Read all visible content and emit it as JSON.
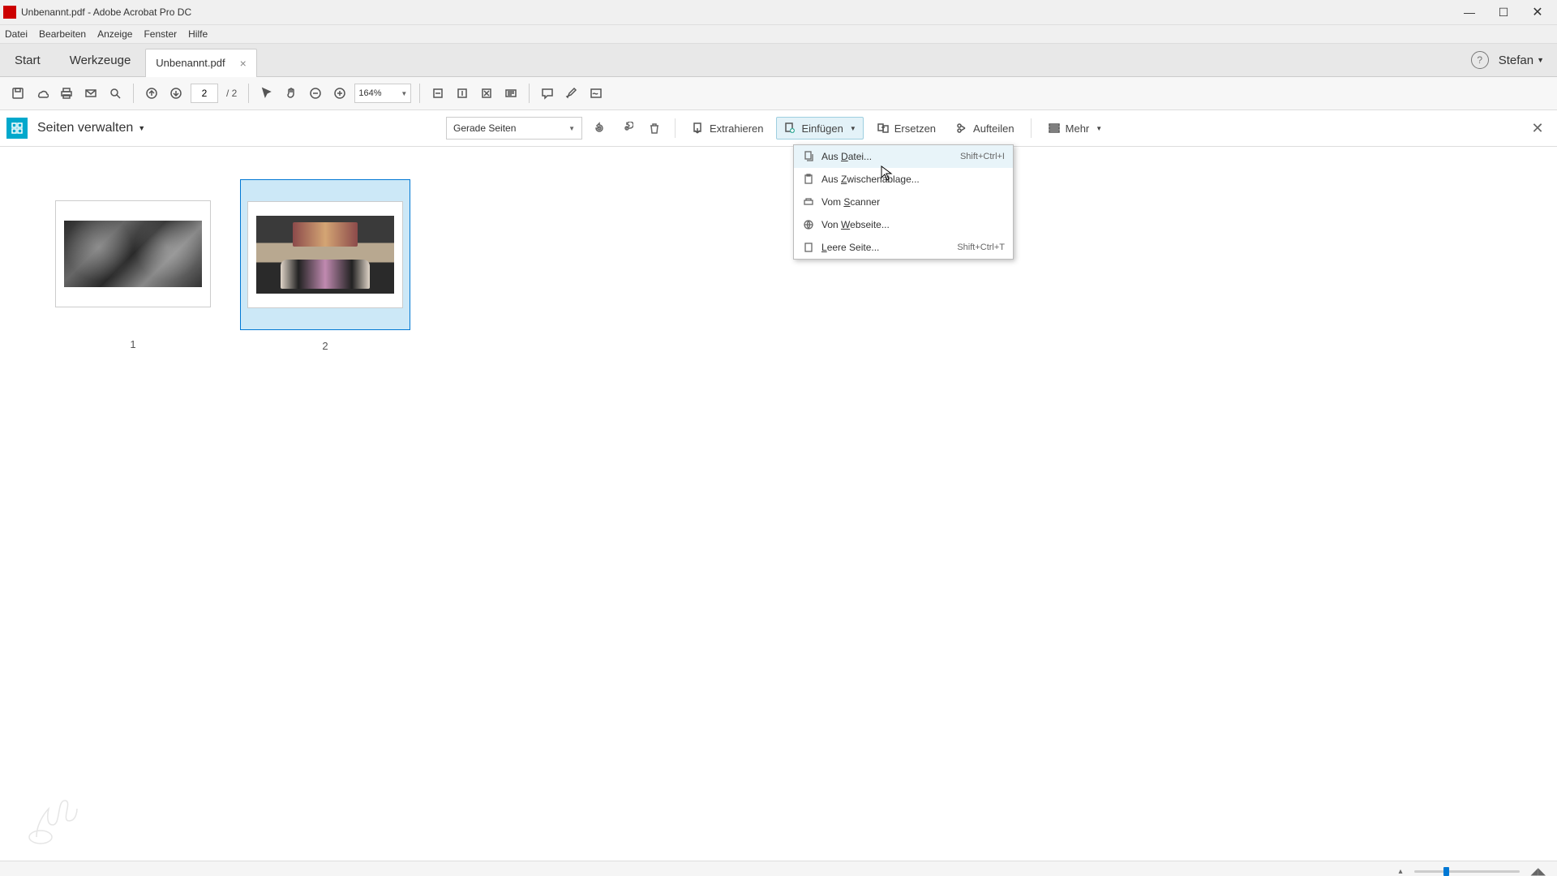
{
  "window": {
    "title": "Unbenannt.pdf - Adobe Acrobat Pro DC"
  },
  "menubar": {
    "items": [
      "Datei",
      "Bearbeiten",
      "Anzeige",
      "Fenster",
      "Hilfe"
    ]
  },
  "tabs": {
    "start": "Start",
    "tools": "Werkzeuge",
    "doc": "Unbenannt.pdf"
  },
  "user": "Stefan",
  "toolbar": {
    "page_current": "2",
    "page_total": "/ 2",
    "zoom": "164%"
  },
  "subtoolbar": {
    "mode_title": "Seiten verwalten",
    "filter": "Gerade Seiten",
    "extract": "Extrahieren",
    "insert": "Einfügen",
    "replace": "Ersetzen",
    "split": "Aufteilen",
    "more": "Mehr"
  },
  "dropdown": {
    "items": [
      {
        "icon": "file",
        "label_pre": "Aus ",
        "accel": "D",
        "label_post": "atei...",
        "shortcut": "Shift+Ctrl+I"
      },
      {
        "icon": "clip",
        "label_pre": "Aus ",
        "accel": "Z",
        "label_post": "wischenablage...",
        "shortcut": ""
      },
      {
        "icon": "scan",
        "label_pre": "Vom ",
        "accel": "S",
        "label_post": "canner",
        "shortcut": ""
      },
      {
        "icon": "web",
        "label_pre": "Von ",
        "accel": "W",
        "label_post": "ebseite...",
        "shortcut": ""
      },
      {
        "icon": "blank",
        "label_pre": "",
        "accel": "L",
        "label_post": "eere Seite...",
        "shortcut": "Shift+Ctrl+T"
      }
    ]
  },
  "thumbs": {
    "p1": "1",
    "p2": "2"
  }
}
